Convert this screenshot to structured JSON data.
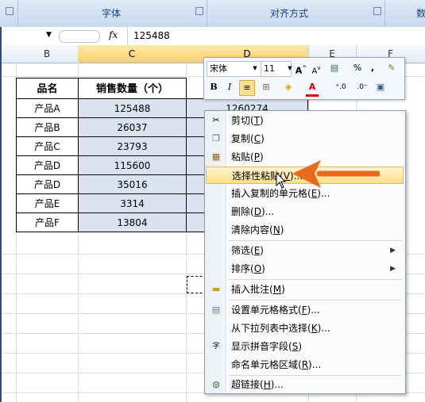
{
  "ribbon": {
    "groups": [
      {
        "label": "字体"
      },
      {
        "label": "对齐方式"
      },
      {
        "label": "数"
      }
    ]
  },
  "formula_bar": {
    "fx_label": "fx",
    "value": "125488"
  },
  "columns": {
    "headers": [
      "B",
      "C",
      "D",
      "E",
      "F"
    ]
  },
  "table": {
    "header_name": "品名",
    "header_qty": "销售数量（个）",
    "rows": [
      {
        "name": "产品A",
        "qty": "125488"
      },
      {
        "name": "产品B",
        "qty": "26037"
      },
      {
        "name": "产品C",
        "qty": "23793"
      },
      {
        "name": "产品D",
        "qty": "115600"
      },
      {
        "name": "产品D",
        "qty": "35016"
      },
      {
        "name": "产品E",
        "qty": "3314"
      },
      {
        "name": "产品F",
        "qty": "13804"
      }
    ],
    "partial_d1": "1260274"
  },
  "mini_toolbar": {
    "font": "宋体",
    "size": "11",
    "percent": "%",
    "comma": ",",
    "bold": "B",
    "italic": "I",
    "font_color_letter": "A"
  },
  "context_menu": {
    "items": [
      {
        "label": "剪切",
        "key": "T",
        "icon": "scissors-icon"
      },
      {
        "label": "复制",
        "key": "C",
        "icon": "copy-icon"
      },
      {
        "label": "粘贴",
        "key": "P",
        "icon": "paste-icon"
      },
      {
        "label": "选择性粘贴",
        "key": "V",
        "suffix": "...",
        "highlighted": true
      },
      {
        "label": "插入复制的单元格",
        "key": "E",
        "suffix": "..."
      },
      {
        "label": "删除",
        "key": "D",
        "suffix": "..."
      },
      {
        "label": "清除内容",
        "key": "N"
      },
      {
        "label": "筛选",
        "key": "E",
        "submenu": true
      },
      {
        "label": "排序",
        "key": "O",
        "submenu": true
      },
      {
        "label": "插入批注",
        "key": "M",
        "icon": "comment-icon"
      },
      {
        "label": "设置单元格格式",
        "key": "F",
        "suffix": "...",
        "icon": "format-cells-icon"
      },
      {
        "label": "从下拉列表中选择",
        "key": "K",
        "suffix": "..."
      },
      {
        "label": "显示拼音字段",
        "key": "S",
        "icon": "phonetic-icon"
      },
      {
        "label": "命名单元格区域",
        "key": "R",
        "suffix": "..."
      },
      {
        "label": "超链接",
        "key": "H",
        "suffix": "...",
        "icon": "hyperlink-icon"
      }
    ]
  },
  "colors": {
    "arrow": "#e86a1c",
    "highlight": "#ffe08a",
    "selected_col": "#f8cf6a",
    "selection_fill": "#dce3f0"
  }
}
